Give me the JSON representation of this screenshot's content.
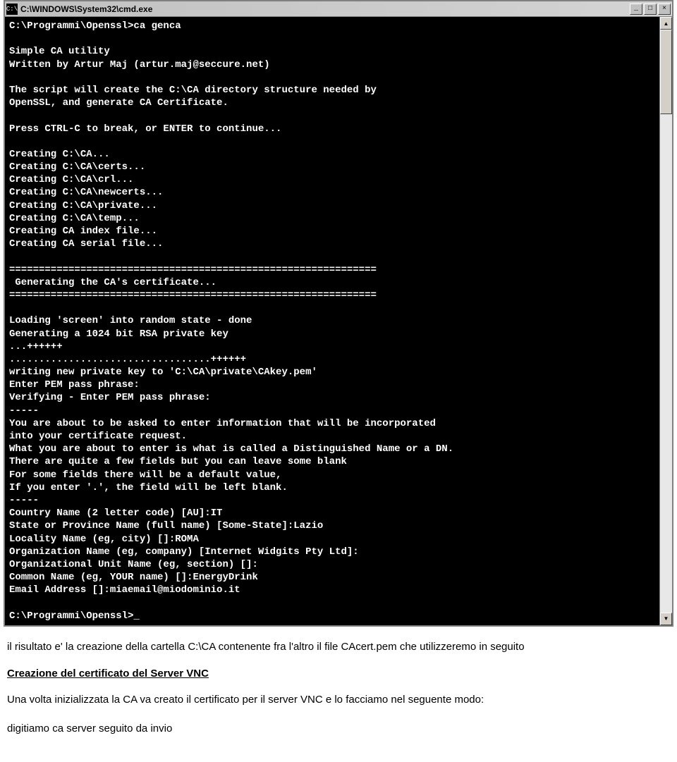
{
  "window": {
    "title": "C:\\WINDOWS\\System32\\cmd.exe",
    "icon_glyph": "C:\\"
  },
  "terminal": {
    "lines": [
      "C:\\Programmi\\Openssl>ca genca",
      "",
      "Simple CA utility",
      "Written by Artur Maj (artur.maj@seccure.net)",
      "",
      "The script will create the C:\\CA directory structure needed by",
      "OpenSSL, and generate CA Certificate.",
      "",
      "Press CTRL-C to break, or ENTER to continue...",
      "",
      "Creating C:\\CA...",
      "Creating C:\\CA\\certs...",
      "Creating C:\\CA\\crl...",
      "Creating C:\\CA\\newcerts...",
      "Creating C:\\CA\\private...",
      "Creating C:\\CA\\temp...",
      "Creating CA index file...",
      "Creating CA serial file...",
      "",
      "==============================================================",
      " Generating the CA's certificate...",
      "==============================================================",
      "",
      "Loading 'screen' into random state - done",
      "Generating a 1024 bit RSA private key",
      "...++++++",
      "..................................++++++",
      "writing new private key to 'C:\\CA\\private\\CAkey.pem'",
      "Enter PEM pass phrase:",
      "Verifying - Enter PEM pass phrase:",
      "-----",
      "You are about to be asked to enter information that will be incorporated",
      "into your certificate request.",
      "What you are about to enter is what is called a Distinguished Name or a DN.",
      "There are quite a few fields but you can leave some blank",
      "For some fields there will be a default value,",
      "If you enter '.', the field will be left blank.",
      "-----",
      "Country Name (2 letter code) [AU]:IT",
      "State or Province Name (full name) [Some-State]:Lazio",
      "Locality Name (eg, city) []:ROMA",
      "Organization Name (eg, company) [Internet Widgits Pty Ltd]:",
      "Organizational Unit Name (eg, section) []:",
      "Common Name (eg, YOUR name) []:EnergyDrink",
      "Email Address []:miaemail@miodominio.it",
      "",
      "C:\\Programmi\\Openssl>_"
    ]
  },
  "document": {
    "paragraph1": "il risultato e' la creazione della cartella C:\\CA contenente fra l'altro il file CAcert.pem che utilizzeremo in seguito",
    "heading": "Creazione del certificato del Server VNC",
    "paragraph2": "Una volta inizializzata la CA va creato il certificato per il server VNC e lo facciamo nel seguente modo:",
    "paragraph3": "digitiamo ca server seguito da invio"
  },
  "buttons": {
    "minimize": "_",
    "maximize": "□",
    "close": "×",
    "scroll_up": "▲",
    "scroll_down": "▼"
  }
}
